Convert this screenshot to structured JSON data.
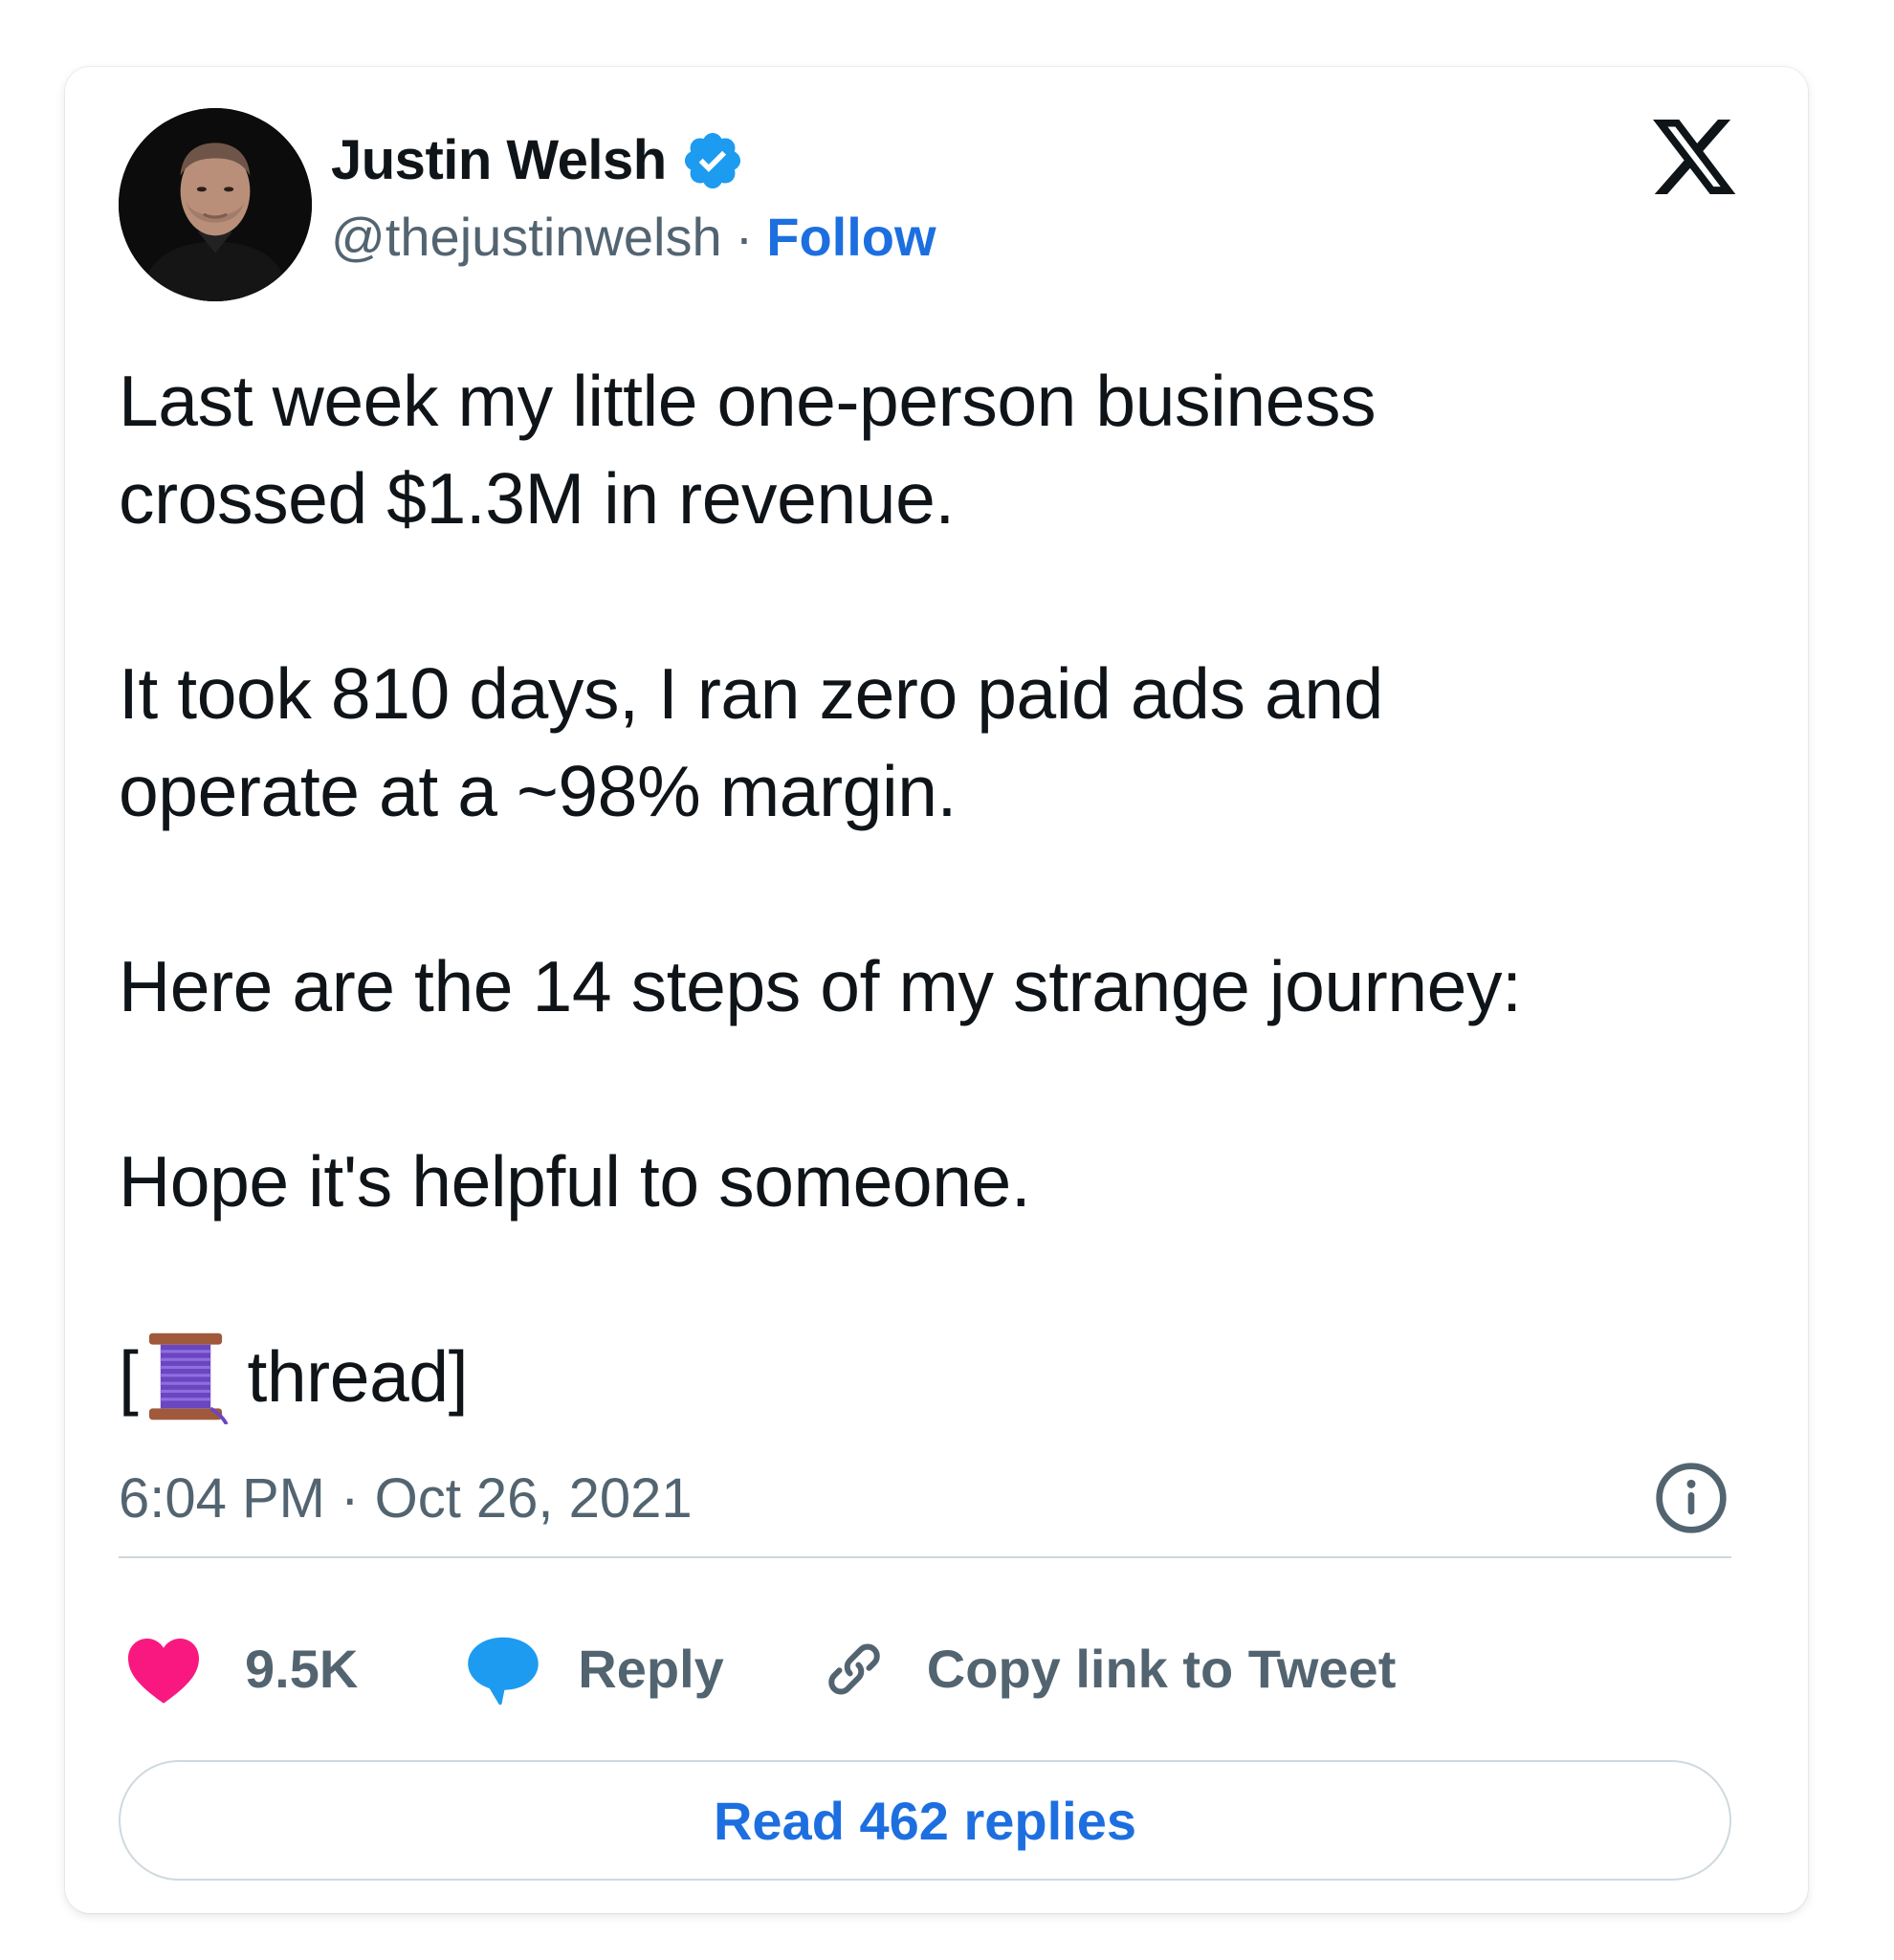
{
  "author": {
    "name": "Justin Welsh",
    "handle": "@thejustinwelsh",
    "separator": "·",
    "follow_label": "Follow",
    "verified": true
  },
  "platform_logo": "x-logo",
  "tweet": {
    "paragraphs": [
      [
        "Last week my little one-person business",
        "crossed $1.3M in revenue."
      ],
      [
        "It took 810 days, I ran zero paid ads and",
        "operate at a ~98% margin."
      ],
      [
        "Here are the 14 steps of my strange journey:"
      ],
      [
        "Hope it's helpful to someone."
      ]
    ],
    "thread_open": "[",
    "thread_emoji": "🧵",
    "thread_text": " thread]"
  },
  "meta": {
    "time": "6:04 PM",
    "separator": "·",
    "date": "Oct 26, 2021"
  },
  "actions": {
    "likes": "9.5K",
    "reply_label": "Reply",
    "copy_link_label": "Copy link to Tweet"
  },
  "read_replies_label": "Read 462 replies",
  "colors": {
    "accent": "#1d6fe0",
    "like": "#f91880",
    "reply": "#1d9bf0",
    "muted": "#536471",
    "text": "#0f1419",
    "verified": "#1d9bf0"
  }
}
